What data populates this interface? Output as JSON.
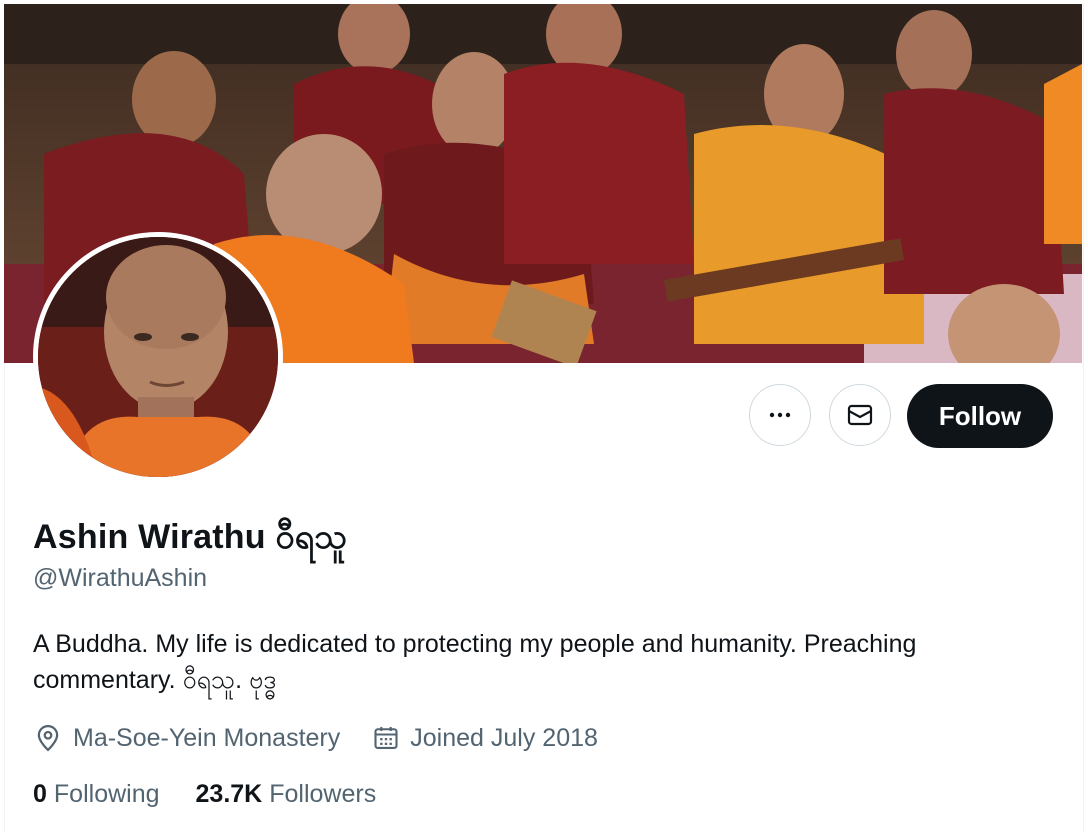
{
  "profile": {
    "display_name": "Ashin Wirathu ဝီရသူ",
    "handle": "@WirathuAshin",
    "bio": "A Buddha. My life is dedicated to protecting my people and humanity. Preaching commentary. ဝီရသူ. ဗုဒ္ဓ",
    "location": "Ma-Soe-Yein Monastery",
    "joined": "Joined July 2018",
    "following_count": "0",
    "following_label": "Following",
    "followers_count": "23.7K",
    "followers_label": "Followers"
  },
  "actions": {
    "follow_label": "Follow",
    "more_icon": "more-horizontal-icon",
    "message_icon": "envelope-icon"
  },
  "icons": {
    "location": "location-pin-icon",
    "calendar": "calendar-icon"
  },
  "colors": {
    "text_primary": "#0f1419",
    "text_secondary": "#536471",
    "button_dark": "#0f1419",
    "border": "#cfd9de"
  }
}
